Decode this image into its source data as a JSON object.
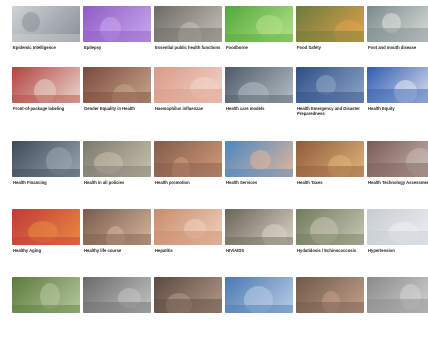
{
  "topics": [
    {
      "label": "Epidemic Intelligence",
      "icon": "keyboard-hands-image",
      "colors": [
        "#cfd3d8",
        "#8a8f96"
      ]
    },
    {
      "label": "Epilepsy",
      "icon": "purple-brain-image",
      "colors": [
        "#8e5cc4",
        "#c9a8ef"
      ]
    },
    {
      "label": "Essential public health functions",
      "icon": "crowd-image",
      "colors": [
        "#6d6a66",
        "#c8c2b8"
      ]
    },
    {
      "label": "Foodborne",
      "icon": "lettuce-image",
      "colors": [
        "#4fa83a",
        "#b7e28a"
      ]
    },
    {
      "label": "Food Safety",
      "icon": "vegetables-image",
      "colors": [
        "#6b7a3c",
        "#e0a34a"
      ]
    },
    {
      "label": "Foot and mouth disease",
      "icon": "cattle-image",
      "colors": [
        "#7a8a88",
        "#e2e4e2"
      ]
    },
    {
      "label": "Front-of-package labeling",
      "icon": "supermarket-image",
      "colors": [
        "#b4423f",
        "#e8d6cc"
      ]
    },
    {
      "label": "Gender Equality in Health",
      "icon": "women-image",
      "colors": [
        "#7a4a3a",
        "#c7a58c"
      ]
    },
    {
      "label": "Haemophilus influenzae",
      "icon": "child-thermometer-image",
      "colors": [
        "#d89a86",
        "#f2d6cb"
      ]
    },
    {
      "label": "Health care models",
      "icon": "clinic-image",
      "colors": [
        "#4d5a66",
        "#b4bec6"
      ]
    },
    {
      "label": "Health Emergency and Disaster Preparedness",
      "icon": "trucks-image",
      "colors": [
        "#2d4e86",
        "#90a7c6"
      ]
    },
    {
      "label": "Health Equity",
      "icon": "banner-image",
      "colors": [
        "#2f5bb0",
        "#e5e9f2"
      ]
    },
    {
      "label": "Health Financing",
      "icon": "calculator-image",
      "colors": [
        "#3d4a57",
        "#9aa7b2"
      ]
    },
    {
      "label": "Health in all policies",
      "icon": "street-image",
      "colors": [
        "#7c786c",
        "#c8c2ae"
      ]
    },
    {
      "label": "Health promotion",
      "icon": "community-image",
      "colors": [
        "#7f5c4a",
        "#d69a7a"
      ]
    },
    {
      "label": "Health Services",
      "icon": "doctor-patient-image",
      "colors": [
        "#4a86c2",
        "#e1b79a"
      ]
    },
    {
      "label": "Health Taxes",
      "icon": "drinks-image",
      "colors": [
        "#8e5b3a",
        "#e0b47a"
      ]
    },
    {
      "label": "Health Technology Assessment",
      "icon": "lab-image",
      "colors": [
        "#7a5a54",
        "#c9bcb4"
      ]
    },
    {
      "label": "Healthy Aging",
      "icon": "abstract-art-image",
      "colors": [
        "#c0393b",
        "#e98a3f"
      ]
    },
    {
      "label": "Healthy life course",
      "icon": "family-image",
      "colors": [
        "#7a5a4a",
        "#d4b59c"
      ]
    },
    {
      "label": "Hepatitis",
      "icon": "hug-image",
      "colors": [
        "#c98a6a",
        "#efd2bd"
      ]
    },
    {
      "label": "HIV/AIDS",
      "icon": "person-image",
      "colors": [
        "#6a6458",
        "#d9d3c6"
      ]
    },
    {
      "label": "Hydatidosis / Echinococcosis",
      "icon": "sheep-image",
      "colors": [
        "#6f7b5c",
        "#c9c7b4"
      ]
    },
    {
      "label": "Hypertension",
      "icon": "blood-pressure-image",
      "colors": [
        "#c7ccd2",
        "#eef1f4"
      ]
    },
    {
      "label": "",
      "icon": "photo-image",
      "colors": [
        "#5c7a3a",
        "#b6c8a0"
      ]
    },
    {
      "label": "",
      "icon": "photo-image",
      "colors": [
        "#6a6a6a",
        "#c4c4c4"
      ]
    },
    {
      "label": "",
      "icon": "photo-image",
      "colors": [
        "#5a4a40",
        "#b59a88"
      ]
    },
    {
      "label": "",
      "icon": "photo-image",
      "colors": [
        "#4a78b0",
        "#b8cde6"
      ]
    },
    {
      "label": "",
      "icon": "photo-image",
      "colors": [
        "#705848",
        "#c2a08c"
      ]
    },
    {
      "label": "",
      "icon": "photo-image",
      "colors": [
        "#8a8a8a",
        "#d6d6d6"
      ]
    }
  ]
}
